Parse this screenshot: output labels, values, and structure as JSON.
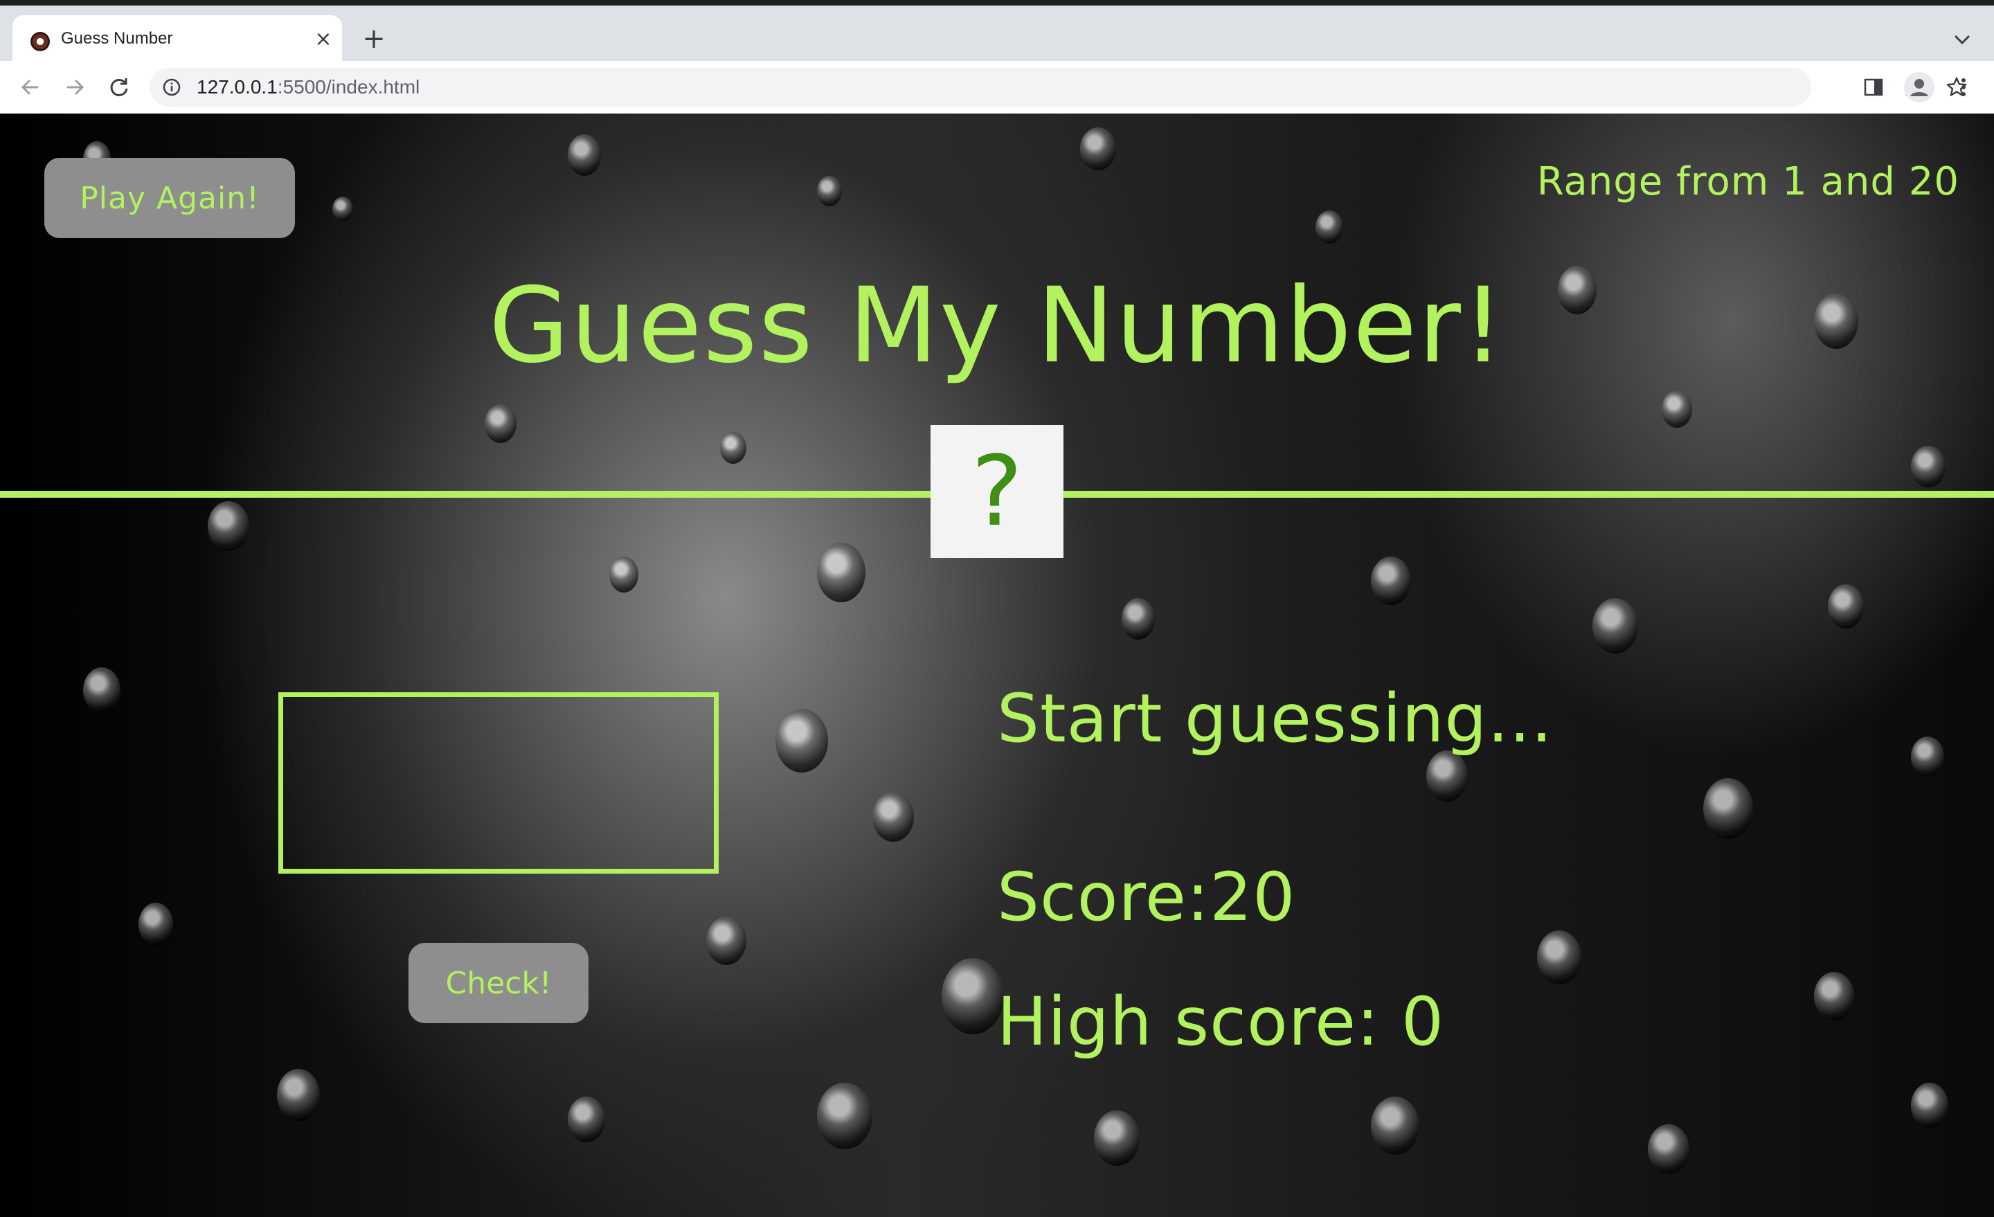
{
  "browser": {
    "tab_title": "Guess Number",
    "tab_close": "×",
    "new_tab": "+",
    "tab_menu": "⌄",
    "url_host": "127.0.0.1",
    "url_path": ":5500/index.html",
    "icons": [
      "back-icon",
      "forward-icon",
      "reload-icon",
      "info-icon",
      "share-icon",
      "star-icon",
      "side-panel-icon",
      "profile-icon",
      "more-icon"
    ]
  },
  "game": {
    "play_again_label": "Play Again!",
    "range_text": "Range from 1 and 20",
    "title": "Guess My Number!",
    "secret_placeholder": "?",
    "guess_value": "",
    "check_label": "Check!",
    "message": "Start guessing...",
    "score_label": "Score:",
    "score_value": "20",
    "highscore_label": "High score: ",
    "highscore_value": "0"
  },
  "colors": {
    "accent": "#b2f25f",
    "button_bg": "#8e8e8e",
    "secret_bg": "#f3f3f3",
    "secret_text": "#3f8f16"
  }
}
